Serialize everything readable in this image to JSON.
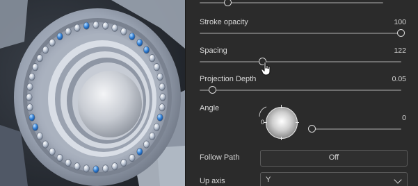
{
  "panel": {
    "top_slider": {
      "value_fraction": 0.1
    },
    "stroke_opacity": {
      "label": "Stroke opacity",
      "value": "100"
    },
    "spacing": {
      "label": "Spacing",
      "value": "122"
    },
    "projection_depth": {
      "label": "Projection Depth",
      "value": "0.05"
    },
    "angle": {
      "label": "Angle",
      "dial_zero": "0",
      "value": "0"
    },
    "follow_path": {
      "label": "Follow Path",
      "button": "Off"
    },
    "up_axis": {
      "label": "Up axis",
      "selected": "Y"
    }
  },
  "icons": [
    "pointer-cursor-icon",
    "chevron-down-icon"
  ],
  "colors": {
    "panel_bg": "#2b2b2b",
    "accent_bead": "#2f7fd6"
  }
}
